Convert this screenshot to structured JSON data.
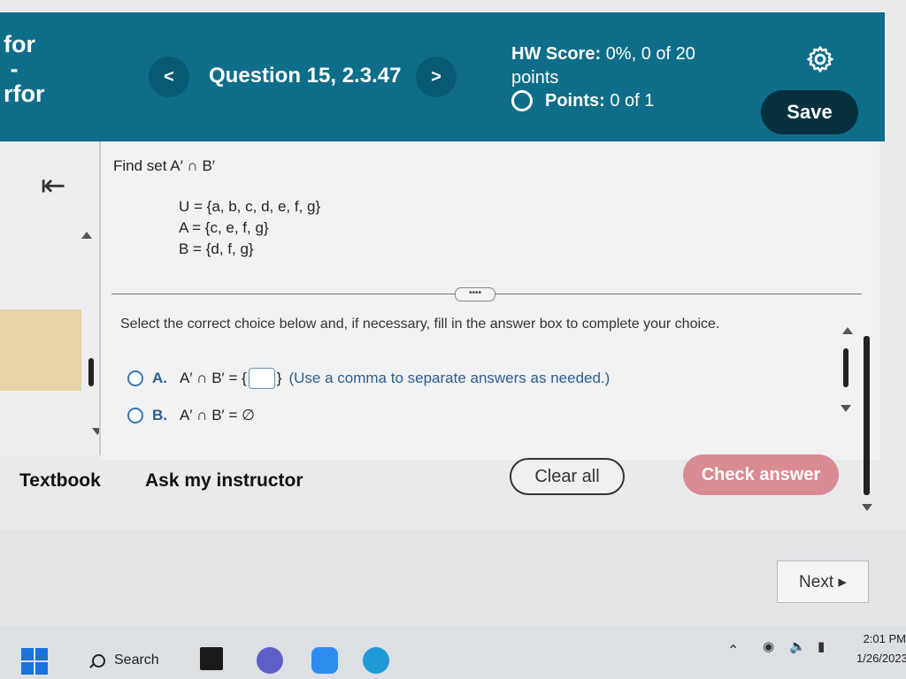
{
  "header": {
    "side_title_lines": [
      "for",
      " -",
      "rfor"
    ],
    "prev_label": "<",
    "next_label": ">",
    "question_title": "Question 15, 2.3.47",
    "hw_score_label": "HW Score:",
    "hw_score_value": "0%, 0 of 20",
    "hw_score_unit": "points",
    "points_label": "Points:",
    "points_value": "0 of 1",
    "save_label": "Save"
  },
  "question": {
    "prompt": "Find set A′ ∩ B′",
    "sets": [
      "U = {a, b, c, d, e, f, g}",
      "A = {c, e, f, g}",
      "B = {d, f, g}"
    ],
    "more_label": "••••",
    "instruction": "Select the correct choice below and, if necessary, fill in the answer box to complete your choice.",
    "choice_a_letter": "A.",
    "choice_a_prefix": "A′ ∩ B′ = {",
    "choice_a_suffix": "}",
    "choice_a_hint": "(Use a comma to separate answers as needed.)",
    "choice_b_letter": "B.",
    "choice_b_text": "A′ ∩ B′ = ∅"
  },
  "footer": {
    "textbook_label": "Textbook",
    "ask_label": "Ask my instructor",
    "clear_label": "Clear all",
    "check_label": "Check answer",
    "next_label": "Next ▸"
  },
  "taskbar": {
    "search_label": "Search",
    "time": "2:01 PM",
    "date": "1/26/2023"
  },
  "colors": {
    "header_bg": "#0e6e8a",
    "save_bg": "#07303f",
    "check_bg": "#d98b93",
    "accent_blue": "#2b5d93"
  }
}
